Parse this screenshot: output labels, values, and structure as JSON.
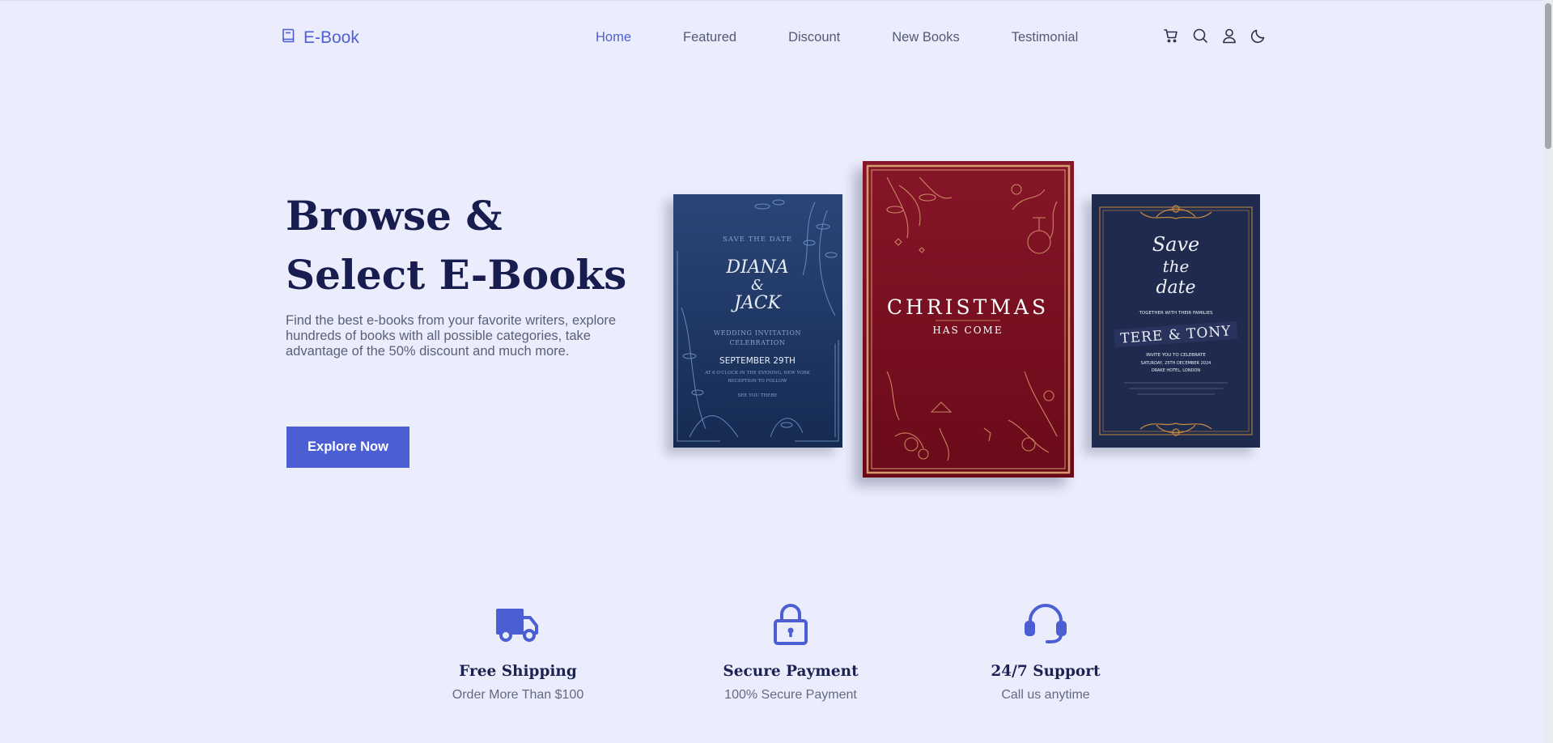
{
  "brand": {
    "name": "E-Book",
    "icon": "book-icon",
    "accent": "#4b5fd3"
  },
  "nav": {
    "items": [
      {
        "label": "Home",
        "active": true
      },
      {
        "label": "Featured",
        "active": false
      },
      {
        "label": "Discount",
        "active": false
      },
      {
        "label": "New Books",
        "active": false
      },
      {
        "label": "Testimonial",
        "active": false
      }
    ],
    "icons": [
      "cart-icon",
      "search-icon",
      "user-icon",
      "moon-icon"
    ]
  },
  "hero": {
    "title_line1": "Browse &",
    "title_line2": "Select E-Books",
    "description": "Find the best e-books from your favorite writers, explore hundreds of books with all possible categories, take advantage of the 50% discount and much more.",
    "button_label": "Explore Now"
  },
  "books": [
    {
      "top": "SAVE THE DATE",
      "name1": "DIANA",
      "amp": "&",
      "name2": "JACK",
      "line1": "WEDDING INVITATION",
      "line2": "CELEBRATION",
      "date": "SEPTEMBER 29TH",
      "line3": "AT 6 O'CLOCK IN THE EVENING, NEW YORK",
      "line4": "RECEPTION TO FOLLOW",
      "line5": "SEE YOU THERE",
      "color": "#1f3563"
    },
    {
      "title": "CHRISTMAS",
      "subtitle": "HAS COME",
      "color": "#7d0f20"
    },
    {
      "script1": "Save",
      "script2": "the",
      "script3": "date",
      "line1": "TOGETHER WITH THEIR FAMILIES",
      "names": "TERE & TONY",
      "line2": "INVITE YOU TO CELEBRATE",
      "line3": "SATURDAY, 25TH DECEMBER 2024",
      "line4": "DRAKE HOTEL, LONDON",
      "color": "#1d2a4d"
    }
  ],
  "features": [
    {
      "icon": "truck-icon",
      "title": "Free Shipping",
      "text": "Order More Than $100"
    },
    {
      "icon": "lock-icon",
      "title": "Secure Payment",
      "text": "100% Secure Payment"
    },
    {
      "icon": "headset-icon",
      "title": "24/7 Support",
      "text": "Call us anytime"
    }
  ]
}
